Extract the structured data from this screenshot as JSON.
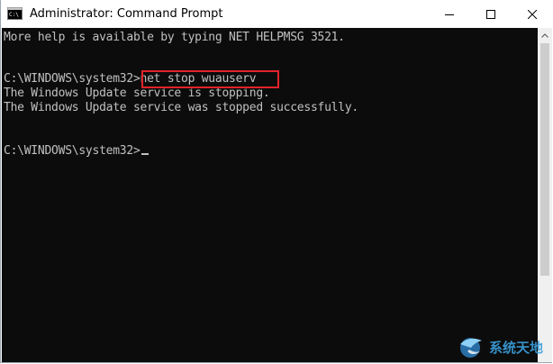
{
  "window": {
    "title": "Administrator: Command Prompt",
    "icon": "cmd-icon",
    "controls": [
      "minimize-icon",
      "maximize-icon",
      "close-icon"
    ]
  },
  "console": {
    "lines": [
      "More help is available by typing NET HELPMSG 3521.",
      "",
      "",
      "C:\\WINDOWS\\system32>net stop wuauserv",
      "The Windows Update service is stopping.",
      "The Windows Update service was stopped successfully.",
      "",
      "",
      "C:\\WINDOWS\\system32>"
    ],
    "highlighted_command": "net stop wuauserv",
    "colors": {
      "background": "#0c0c0c",
      "text": "#c0c0c0",
      "highlight": "#e2232a"
    }
  },
  "watermark": {
    "text": "系统天地",
    "logo": "bird-logo-icon"
  }
}
